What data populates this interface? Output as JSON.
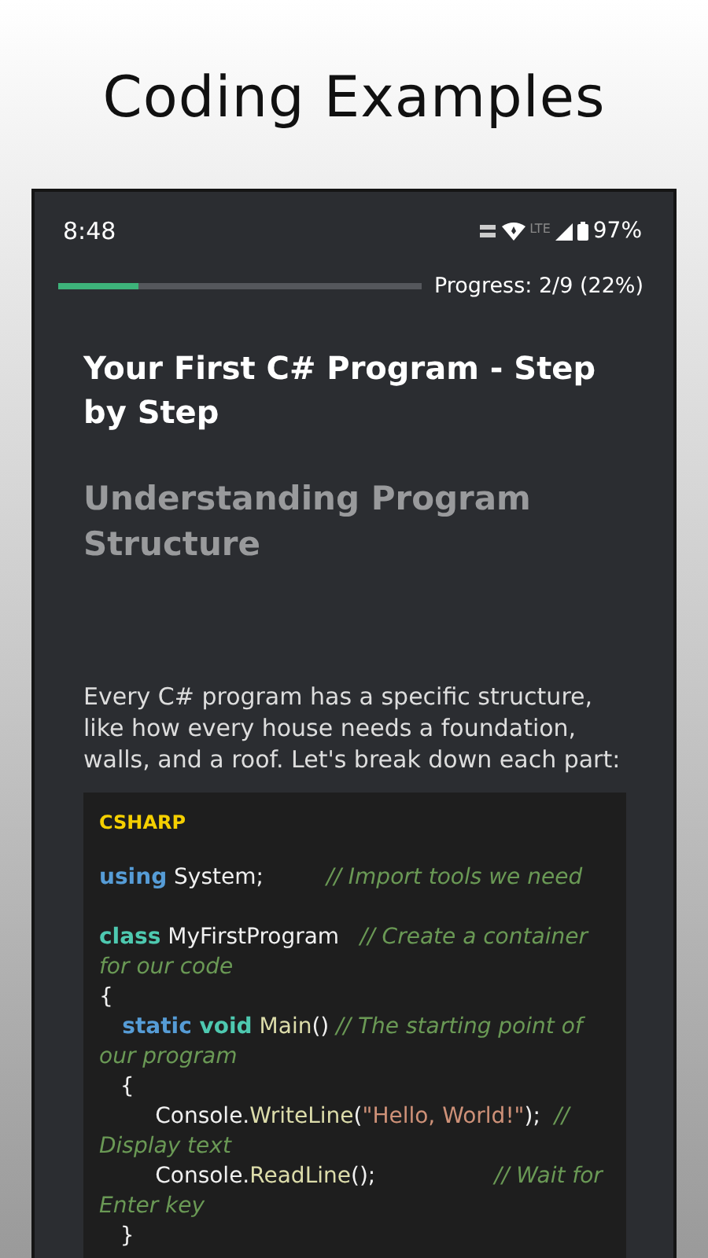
{
  "promo_title": "Coding Examples",
  "status_bar": {
    "time": "8:48",
    "network": "LTE",
    "battery": "97%"
  },
  "progress": {
    "level": 0.22,
    "label": "Progress: 2/9 (22%)"
  },
  "lesson": {
    "title": "Your First C# Program - Step by Step",
    "section_title": "Understanding Program Structure",
    "intro": "Every C# program has a specific structure, like how every house needs a foundation, walls, and a roof. Let's break down each part:"
  },
  "code_block": {
    "language": "CSHARP",
    "lines": [
      {
        "kind": "blank"
      },
      {
        "kind": "code",
        "tokens": [
          {
            "kind": "keyword",
            "text": "using"
          },
          {
            "kind": "plain",
            "text": " System;         "
          },
          {
            "kind": "comment",
            "text": "// Import tools we need"
          }
        ]
      },
      {
        "kind": "blank"
      },
      {
        "kind": "code",
        "tokens": [
          {
            "kind": "type",
            "text": "class"
          },
          {
            "kind": "plain",
            "text": " MyFirstProgram   "
          },
          {
            "kind": "comment",
            "text": "// Create a container for our code"
          }
        ]
      },
      {
        "kind": "code",
        "tokens": [
          {
            "kind": "plain",
            "text": "{"
          }
        ]
      },
      {
        "kind": "code",
        "tokens": [
          {
            "kind": "keyword",
            "text": "   static"
          },
          {
            "kind": "type",
            "text": " void"
          },
          {
            "kind": "method",
            "text": " Main"
          },
          {
            "kind": "plain",
            "text": "() "
          },
          {
            "kind": "comment",
            "text": "// The starting point of our program"
          }
        ]
      },
      {
        "kind": "code",
        "tokens": [
          {
            "kind": "plain",
            "text": "   {"
          }
        ]
      },
      {
        "kind": "code",
        "tokens": [
          {
            "kind": "plain",
            "text": "        Console."
          },
          {
            "kind": "method",
            "text": "WriteLine"
          },
          {
            "kind": "plain",
            "text": "("
          },
          {
            "kind": "string",
            "text": "\"Hello, World!\""
          },
          {
            "kind": "plain",
            "text": ");  "
          },
          {
            "kind": "comment",
            "text": "// Display text"
          }
        ]
      },
      {
        "kind": "code",
        "tokens": [
          {
            "kind": "plain",
            "text": "        Console."
          },
          {
            "kind": "method",
            "text": "ReadLine"
          },
          {
            "kind": "plain",
            "text": "();                 "
          },
          {
            "kind": "comment",
            "text": "// Wait for Enter key"
          }
        ]
      },
      {
        "kind": "code",
        "tokens": [
          {
            "kind": "plain",
            "text": "   }"
          }
        ]
      }
    ]
  }
}
